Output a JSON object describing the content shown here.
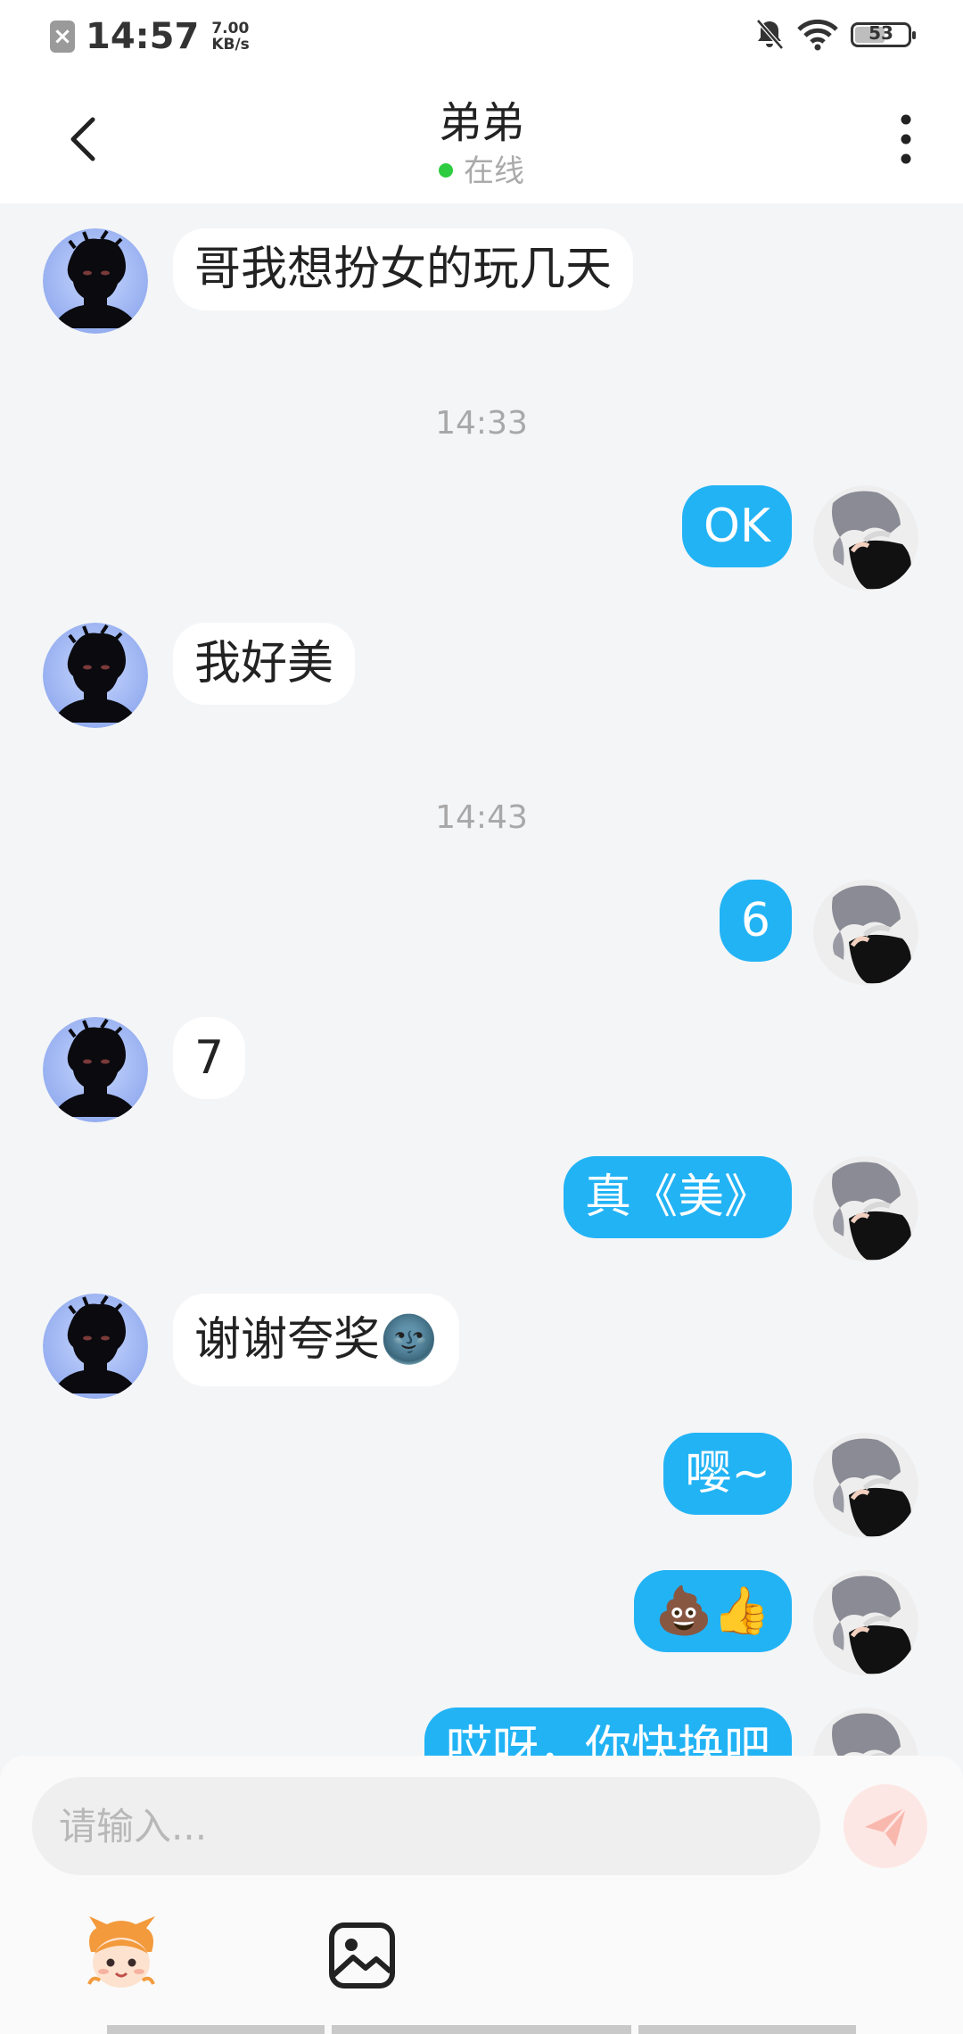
{
  "status_bar": {
    "time": "14:57",
    "speed_value": "7.00",
    "speed_unit": "KB/s",
    "battery": "53",
    "icons": [
      "notification-off-icon",
      "wifi-icon",
      "battery-icon"
    ]
  },
  "header": {
    "title": "弟弟",
    "status": "在线",
    "status_color": "#2ecc40"
  },
  "messages": [
    {
      "side": "in",
      "text": "哥我想扮女的玩几天"
    },
    {
      "type": "time",
      "text": "14:33"
    },
    {
      "side": "out",
      "text": "OK"
    },
    {
      "side": "in",
      "text": "我好美"
    },
    {
      "type": "time",
      "text": "14:43"
    },
    {
      "side": "out",
      "text": "6"
    },
    {
      "side": "in",
      "text": "7"
    },
    {
      "side": "out",
      "text": "真《美》"
    },
    {
      "side": "in",
      "text": "谢谢夸奖🌚"
    },
    {
      "side": "out",
      "text": "嘤~"
    },
    {
      "side": "out",
      "text": "💩👍"
    },
    {
      "side": "out",
      "text": "哎呀，你快换吧"
    }
  ],
  "composer": {
    "placeholder": "请输入...",
    "tools": [
      "mascot-emoji-icon",
      "image-icon"
    ]
  },
  "colors": {
    "outgoing_bubble": "#22b3f5",
    "incoming_bubble": "#ffffff",
    "background": "#f4f5f7"
  }
}
